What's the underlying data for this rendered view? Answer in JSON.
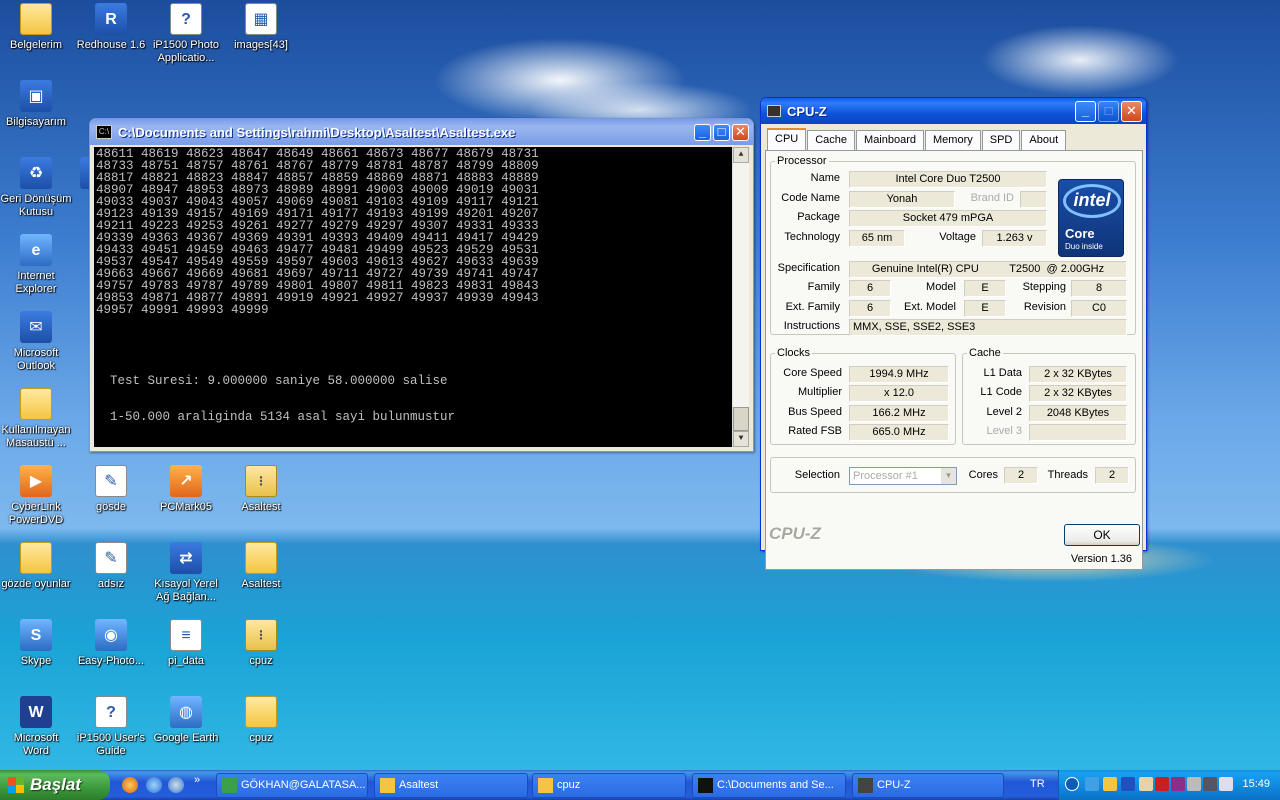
{
  "desktop_icons": [
    {
      "label": "Belgelerim",
      "icon": "folder-documents-icon"
    },
    {
      "label": "Redhouse 1.6",
      "icon": "redhouse-app-icon",
      "glyph": "R"
    },
    {
      "label": "iP1500 Photo Applicatio...",
      "icon": "help-book-icon",
      "glyph": "?"
    },
    {
      "label": "images[43]",
      "icon": "image-file-icon",
      "glyph": "▦"
    },
    {
      "label": "Bilgisayarım",
      "icon": "my-computer-icon",
      "glyph": "▣"
    },
    {
      "label": "Geri Dönüşüm Kutusu",
      "icon": "recycle-bin-icon",
      "glyph": "♻"
    },
    {
      "label": "su",
      "icon": "partial-icon"
    },
    {
      "label": "Internet Explorer",
      "icon": "internet-explorer-icon",
      "glyph": "e"
    },
    {
      "label": "Microsoft Outlook",
      "icon": "outlook-icon",
      "glyph": "✉"
    },
    {
      "label": "Kullanılmayan Masaüstü ...",
      "icon": "folder-icon"
    },
    {
      "label": "CyberLink PowerDVD",
      "icon": "powerdvd-icon",
      "glyph": "▶"
    },
    {
      "label": "gösde",
      "icon": "document-shortcut-icon",
      "glyph": "✎"
    },
    {
      "label": "PCMark05",
      "icon": "pcmark-icon",
      "glyph": "↗"
    },
    {
      "label": "Asaltest",
      "icon": "zip-folder-icon",
      "glyph": "⋮"
    },
    {
      "label": "gözde oyunlar",
      "icon": "folder-icon"
    },
    {
      "label": "adsız",
      "icon": "document-shortcut-icon",
      "glyph": "✎"
    },
    {
      "label": "Kısayol Yerel Ağ Bağlan...",
      "icon": "network-connection-icon",
      "glyph": "⇄"
    },
    {
      "label": "Asaltest",
      "icon": "folder-icon"
    },
    {
      "label": "Skype",
      "icon": "skype-icon",
      "glyph": "S"
    },
    {
      "label": "Easy-Photo...",
      "icon": "easy-photo-icon",
      "glyph": "◉"
    },
    {
      "label": "pi_data",
      "icon": "text-file-icon",
      "glyph": "≡"
    },
    {
      "label": "cpuz",
      "icon": "zip-folder-icon",
      "glyph": "⋮"
    },
    {
      "label": "Microsoft Word",
      "icon": "word-icon",
      "glyph": "W"
    },
    {
      "label": "iP1500 User's Guide",
      "icon": "help-book-icon",
      "glyph": "?"
    },
    {
      "label": "Google Earth",
      "icon": "google-earth-icon",
      "glyph": "◍"
    },
    {
      "label": "cpuz",
      "icon": "folder-icon"
    }
  ],
  "console": {
    "title": "C:\\Documents and Settings\\rahmi\\Desktop\\Asaltest\\Asaltest.exe",
    "icon_text": "C:\\",
    "lines": [
      "48611 48619 48623 48647 48649 48661 48673 48677 48679 48731",
      "48733 48751 48757 48761 48767 48779 48781 48787 48799 48809",
      "48817 48821 48823 48847 48857 48859 48869 48871 48883 48889",
      "48907 48947 48953 48973 48989 48991 49003 49009 49019 49031",
      "49033 49037 49043 49057 49069 49081 49103 49109 49117 49121",
      "49123 49139 49157 49169 49171 49177 49193 49199 49201 49207",
      "49211 49223 49253 49261 49277 49279 49297 49307 49331 49333",
      "49339 49363 49367 49369 49391 49393 49409 49411 49417 49429",
      "49433 49451 49459 49463 49477 49481 49499 49523 49529 49531",
      "49537 49547 49549 49559 49597 49603 49613 49627 49633 49639",
      "49663 49667 49669 49681 49697 49711 49727 49739 49741 49747",
      "49757 49783 49787 49789 49801 49807 49811 49823 49831 49843",
      "49853 49871 49877 49891 49919 49921 49927 49937 49939 49943",
      "49957 49991 49993 49999"
    ],
    "test_time": "Test Suresi: 9.000000 saniye 58.000000 salise",
    "result": "1-50.000 araliginda 5134 asal sayi bulunmustur"
  },
  "cpuz": {
    "title": "CPU-Z",
    "tabs": [
      "CPU",
      "Cache",
      "Mainboard",
      "Memory",
      "SPD",
      "About"
    ],
    "processor": {
      "legend": "Processor",
      "name_label": "Name",
      "name": "Intel Core Duo T2500",
      "codename_label": "Code Name",
      "codename": "Yonah",
      "brandid_label": "Brand ID",
      "package_label": "Package",
      "package": "Socket 479 mPGA",
      "technology_label": "Technology",
      "technology": "65 nm",
      "voltage_label": "Voltage",
      "voltage": "1.263 v",
      "spec_label": "Specification",
      "spec": "Genuine Intel(R) CPU          T2500  @ 2.00GHz",
      "family_label": "Family",
      "family": "6",
      "model_label": "Model",
      "model": "E",
      "stepping_label": "Stepping",
      "stepping": "8",
      "extfamily_label": "Ext. Family",
      "extfamily": "6",
      "extmodel_label": "Ext. Model",
      "extmodel": "E",
      "revision_label": "Revision",
      "revision": "C0",
      "instructions_label": "Instructions",
      "instructions": "MMX, SSE, SSE2, SSE3"
    },
    "logo": {
      "brand": "intel",
      "line1": "Core",
      "line2": "Duo inside"
    },
    "clocks": {
      "legend": "Clocks",
      "core_speed_label": "Core Speed",
      "core_speed": "1994.9 MHz",
      "multiplier_label": "Multiplier",
      "multiplier": "x 12.0",
      "bus_speed_label": "Bus Speed",
      "bus_speed": "166.2 MHz",
      "rated_fsb_label": "Rated FSB",
      "rated_fsb": "665.0 MHz"
    },
    "cache": {
      "legend": "Cache",
      "l1data_label": "L1 Data",
      "l1data": "2 x 32 KBytes",
      "l1code_label": "L1 Code",
      "l1code": "2 x 32 KBytes",
      "level2_label": "Level 2",
      "level2": "2048 KBytes",
      "level3_label": "Level 3"
    },
    "selection_label": "Selection",
    "selection": "Processor #1",
    "cores_label": "Cores",
    "cores": "2",
    "threads_label": "Threads",
    "threads": "2",
    "version": "Version 1.36",
    "footer_logo": "CPU-Z",
    "ok": "OK"
  },
  "taskbar": {
    "start": "Başlat",
    "items": [
      {
        "label": "GÖKHAN@GALATASA...",
        "icon": "messenger-icon"
      },
      {
        "label": "Asaltest",
        "icon": "folder-icon"
      },
      {
        "label": "cpuz",
        "icon": "folder-icon"
      },
      {
        "label": "C:\\Documents and Se...",
        "icon": "console-icon"
      },
      {
        "label": "CPU-Z",
        "icon": "cpuz-icon"
      }
    ],
    "language": "TR",
    "clock": "15:49"
  }
}
